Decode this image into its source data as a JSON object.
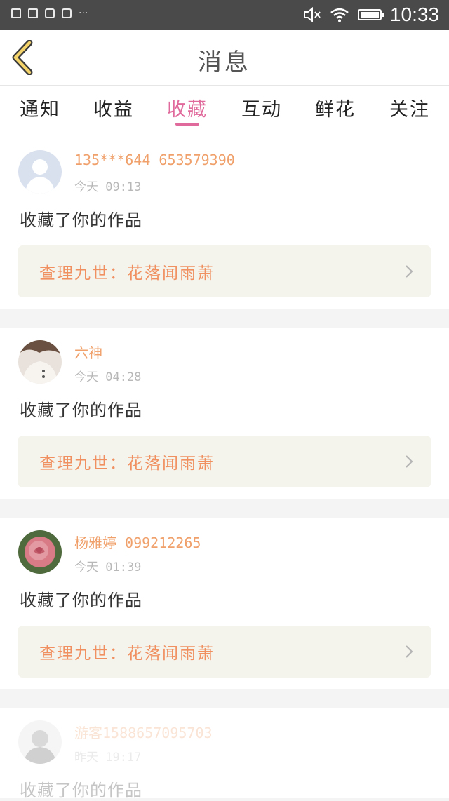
{
  "status_bar": {
    "time": "10:33",
    "icons": [
      "image-icon",
      "calendar-icon",
      "mail-icon",
      "mail-icon",
      "more-dots-icon",
      "mute-icon",
      "wifi-icon",
      "battery-icon"
    ]
  },
  "header": {
    "title": "消息"
  },
  "tabs": [
    {
      "label": "通知"
    },
    {
      "label": "收益"
    },
    {
      "label": "收藏"
    },
    {
      "label": "互动"
    },
    {
      "label": "鲜花"
    },
    {
      "label": "关注"
    }
  ],
  "active_tab": "收藏",
  "colors": {
    "accent": "#e06a9b",
    "username": "#f0a06a",
    "work_title": "#f09060",
    "work_box_bg": "#f4f3ec",
    "status_bar": "#4a4a4a"
  },
  "messages": [
    {
      "username": "135***644_653579390",
      "time": "今天 09:13",
      "action": "收藏了你的作品",
      "work_title": "查理九世：花落闻雨萧",
      "avatar": "default-avatar"
    },
    {
      "username": "六神",
      "time": "今天 04:28",
      "action": "收藏了你的作品",
      "work_title": "查理九世：花落闻雨萧",
      "avatar": "photo-avatar"
    },
    {
      "username": "杨雅婷_099212265",
      "time": "今天 01:39",
      "action": "收藏了你的作品",
      "work_title": "查理九世：花落闻雨萧",
      "avatar": "rose-avatar"
    },
    {
      "username": "游客1588657095703",
      "time": "昨天 19:17",
      "action": "收藏了你的作品",
      "avatar": "photo-avatar"
    }
  ]
}
